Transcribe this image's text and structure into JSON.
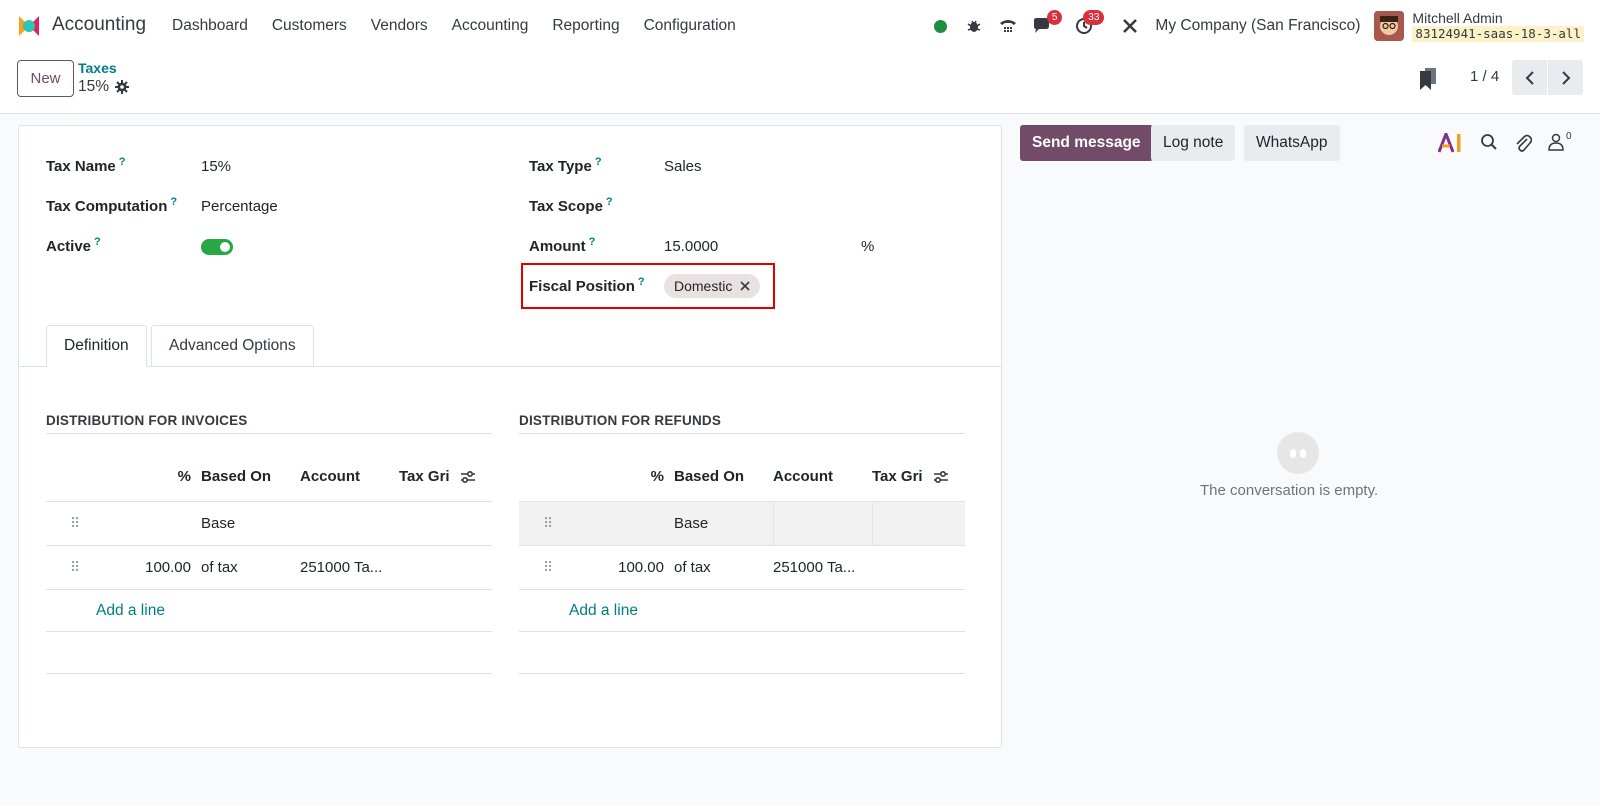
{
  "navbar": {
    "app_name": "Accounting",
    "menu": [
      "Dashboard",
      "Customers",
      "Vendors",
      "Accounting",
      "Reporting",
      "Configuration"
    ],
    "messages_count": "5",
    "activities_count": "33",
    "company": "My Company (San Francisco)",
    "user_name": "Mitchell Admin",
    "db_name": "83124941-saas-18-3-all"
  },
  "control": {
    "new_label": "New",
    "breadcrumb_parent": "Taxes",
    "breadcrumb_current": "15%",
    "pager": "1 / 4"
  },
  "form": {
    "tax_name_label": "Tax Name",
    "tax_name_value": "15%",
    "tax_computation_label": "Tax Computation",
    "tax_computation_value": "Percentage",
    "active_label": "Active",
    "active": true,
    "tax_type_label": "Tax Type",
    "tax_type_value": "Sales",
    "tax_scope_label": "Tax Scope",
    "amount_label": "Amount",
    "amount_value": "15.0000",
    "amount_unit": "%",
    "fiscal_position_label": "Fiscal Position",
    "fiscal_position_tag": "Domestic",
    "help_mark": "?"
  },
  "tabs": [
    "Definition",
    "Advanced Options"
  ],
  "invoices": {
    "title": "DISTRIBUTION FOR INVOICES",
    "headers": [
      "%",
      "Based On",
      "Account",
      "Tax Gri"
    ],
    "rows": [
      {
        "pct": "",
        "based": "Base",
        "account": ""
      },
      {
        "pct": "100.00",
        "based": "of tax",
        "account": "251000 Ta..."
      }
    ],
    "add_line": "Add a line"
  },
  "refunds": {
    "title": "DISTRIBUTION FOR REFUNDS",
    "headers": [
      "%",
      "Based On",
      "Account",
      "Tax Gri"
    ],
    "rows": [
      {
        "pct": "",
        "based": "Base",
        "account": ""
      },
      {
        "pct": "100.00",
        "based": "of tax",
        "account": "251000 Ta..."
      }
    ],
    "add_line": "Add a line"
  },
  "chatter": {
    "send_message": "Send message",
    "log_note": "Log note",
    "whatsapp": "WhatsApp",
    "followers_count": "0",
    "empty_text": "The conversation is empty."
  },
  "colors": {
    "primary": "#714b67",
    "link": "#017e84",
    "highlight": "#e00000",
    "online": "#28a745",
    "badge": "#d9303e"
  }
}
